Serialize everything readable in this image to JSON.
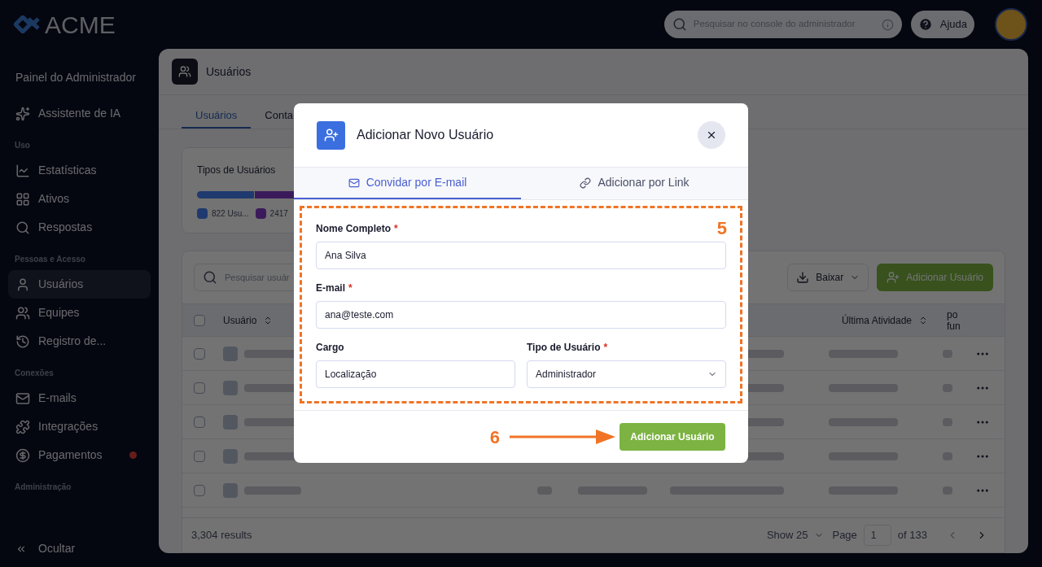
{
  "brand": {
    "name": "ACME"
  },
  "top_bar": {
    "search": {
      "placeholder": "Pesquisar no console do administrador"
    },
    "help_button": "Ajuda"
  },
  "sidebar": {
    "title": "Painel do Administrador",
    "sections": [
      {
        "items": [
          {
            "label": "Assistente de IA",
            "selected": false,
            "alert": false
          }
        ]
      },
      {
        "heading": "Uso",
        "items": [
          {
            "label": "Estatísticas",
            "selected": false,
            "alert": false
          },
          {
            "label": "Ativos",
            "selected": false,
            "alert": false
          },
          {
            "label": "Respostas",
            "selected": false,
            "alert": false
          }
        ]
      },
      {
        "heading": "Pessoas e Acesso",
        "items": [
          {
            "label": "Usuários",
            "selected": true,
            "alert": false
          },
          {
            "label": "Equipes",
            "selected": false,
            "alert": false
          },
          {
            "label": "Registro de...",
            "selected": false,
            "alert": false
          }
        ]
      },
      {
        "heading": "Conexões",
        "items": [
          {
            "label": "E-mails",
            "selected": false,
            "alert": false
          },
          {
            "label": "Integrações",
            "selected": false,
            "alert": false
          },
          {
            "label": "Pagamentos",
            "selected": false,
            "alert": true
          }
        ]
      },
      {
        "heading": "Administração"
      }
    ],
    "collapse_button": "Ocultar"
  },
  "page": {
    "title": "Usuários",
    "tabs": [
      {
        "label": "Usuários",
        "selected": true
      },
      {
        "label": "Conta",
        "selected": false
      }
    ],
    "user_types_card": {
      "title": "Tipos de Usuários",
      "legend": [
        {
          "label": "822 Usu...",
          "color": "#1f3a6e",
          "level": 0.25
        },
        {
          "label": "2417",
          "color": "#3b1a5c",
          "level": 0.73
        }
      ]
    },
    "table": {
      "search": {
        "placeholder": "Pesquisar usuár"
      },
      "download_button": "Baixar",
      "add_button": "Adicionar Usuário",
      "select_all_checked": false,
      "columns": [
        "Usuário",
        "Última Atividade",
        "po fun"
      ],
      "rows": [
        {
          "checked": false
        },
        {
          "checked": false
        },
        {
          "checked": false
        },
        {
          "checked": false
        },
        {
          "checked": false
        }
      ],
      "results": "3,304 results",
      "page_size": "Show 25",
      "page_label": "Page",
      "page": "1",
      "page_total": "of 133"
    }
  },
  "modal": {
    "title": "Adicionar Novo Usuário",
    "tabs": [
      {
        "label": "Convidar por E-mail",
        "selected": true
      },
      {
        "label": "Adicionar por Link",
        "selected": false
      }
    ],
    "form_rows": [
      [
        {
          "label": "Nome Completo",
          "required_mark": "*",
          "value": "Ana Silva",
          "kind": "text"
        }
      ],
      [
        {
          "label": "E-mail",
          "required_mark": "*",
          "value": "ana@teste.com",
          "kind": "text"
        }
      ],
      [
        {
          "label": "Cargo",
          "value": "Localização",
          "kind": "text"
        },
        {
          "label": "Tipo de Usuário",
          "required_mark": "*",
          "value": "Administrador",
          "kind": "select"
        }
      ]
    ],
    "submit_button": "Adicionar Usuário"
  },
  "annotations": [
    {
      "label": "5"
    },
    {
      "label": "6"
    }
  ]
}
